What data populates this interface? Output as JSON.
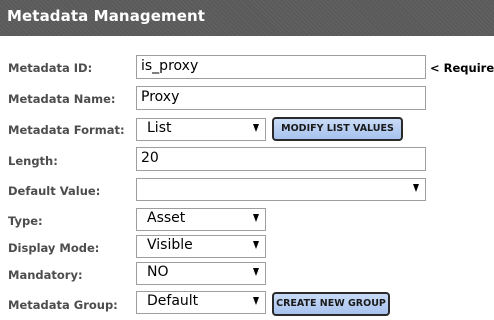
{
  "header": {
    "title": "Metadata Management"
  },
  "form": {
    "metadata_id": {
      "label": "Metadata ID:",
      "value": "is_proxy",
      "note": "< Required"
    },
    "metadata_name": {
      "label": "Metadata Name:",
      "value": "Proxy"
    },
    "metadata_format": {
      "label": "Metadata Format:",
      "selected": "List",
      "button_label": "MODIFY LIST VALUES"
    },
    "length": {
      "label": "Length:",
      "value": "20"
    },
    "default_value": {
      "label": "Default Value:",
      "selected": ""
    },
    "type": {
      "label": "Type:",
      "selected": "Asset"
    },
    "display_mode": {
      "label": "Display Mode:",
      "selected": "Visible"
    },
    "mandatory": {
      "label": "Mandatory:",
      "selected": "NO"
    },
    "metadata_group": {
      "label": "Metadata Group:",
      "selected": "Default",
      "button_label": "CREATE NEW GROUP"
    }
  },
  "colors": {
    "header_bg": "#5a5a5a",
    "button_bg": "#b8cff3",
    "label_text": "#4d4d4d"
  }
}
